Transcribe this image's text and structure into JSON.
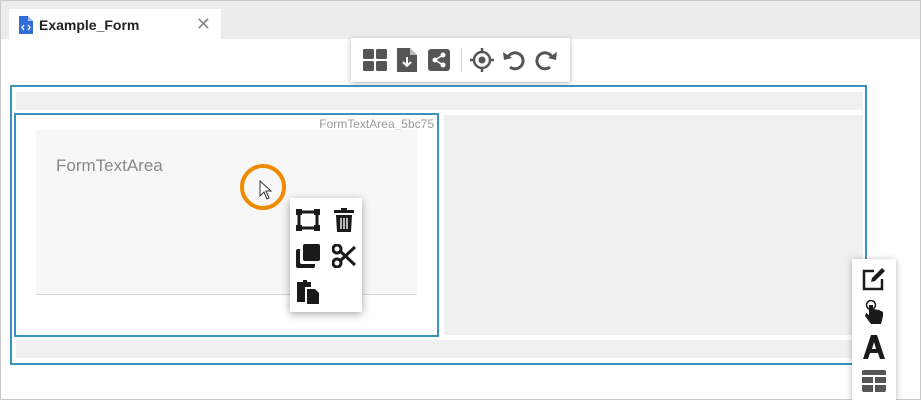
{
  "tab": {
    "title": "Example_Form",
    "close_symbol": "✕",
    "icon": "code-file-icon",
    "icon_color": "#2f6fd6"
  },
  "toolbar": {
    "buttons": [
      "layout-icon",
      "download-file-icon",
      "share-icon",
      "locate-icon",
      "undo-icon",
      "redo-icon"
    ]
  },
  "form": {
    "component_label": "FormTextArea_5bc75",
    "textarea_placeholder": "FormTextArea",
    "accent_color": "#3a92bd"
  },
  "context_menu": {
    "items": [
      "select-parent-icon",
      "delete-icon",
      "copy-icon",
      "cut-icon",
      "paste-icon"
    ]
  },
  "side_panel": {
    "items": [
      "edit-icon",
      "interaction-icon",
      "text-style-icon",
      "table-layout-icon"
    ]
  },
  "cursor_highlight_color": "#f08a00"
}
